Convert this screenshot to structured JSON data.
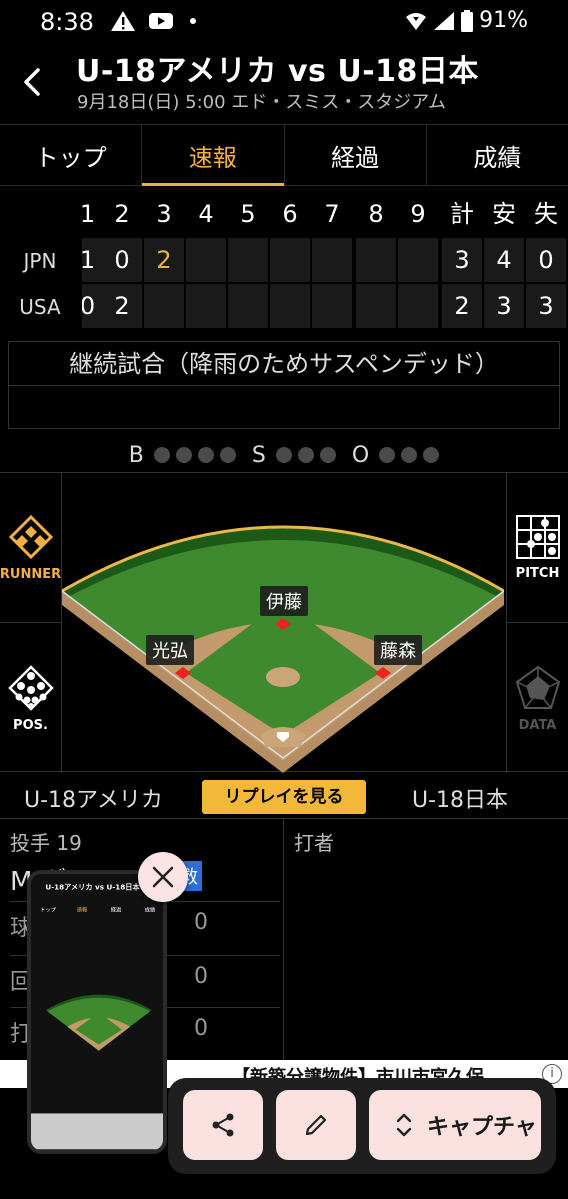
{
  "status": {
    "time": "8:38",
    "battery": "91%"
  },
  "header": {
    "title": "U-18アメリカ vs U-18日本",
    "subtitle": "9月18日(日) 5:00 エド・スミス・スタジアム"
  },
  "tabs": [
    {
      "label": "トップ",
      "active": false
    },
    {
      "label": "速報",
      "active": true
    },
    {
      "label": "経過",
      "active": false
    },
    {
      "label": "成績",
      "active": false
    }
  ],
  "scoreboard": {
    "columns": [
      "1",
      "2",
      "3",
      "4",
      "5",
      "6",
      "7",
      "8",
      "9",
      "計",
      "安",
      "失"
    ],
    "rows": [
      {
        "team": "JPN",
        "cells": [
          "1",
          "0",
          "2",
          "",
          "",
          "",
          "",
          "",
          "",
          "3",
          "4",
          "0"
        ]
      },
      {
        "team": "USA",
        "cells": [
          "0",
          "2",
          "",
          "",
          "",
          "",
          "",
          "",
          "",
          "2",
          "3",
          "3"
        ]
      }
    ]
  },
  "suspend_notice": "継続試合（降雨のためサスペンデッド）",
  "count": {
    "b_label": "B",
    "s_label": "S",
    "o_label": "O"
  },
  "side_buttons": {
    "runner": "RUNNER",
    "pitch": "PITCH",
    "pos": "POS.",
    "data": "DATA"
  },
  "fielders": {
    "center": "伊藤",
    "left": "光弘",
    "right": "藤森"
  },
  "teams": {
    "away": "U-18アメリカ",
    "replay": "リプレイを見る",
    "home": "U-18日本"
  },
  "matchup": {
    "pitcher_label": "投手 19",
    "pitcher_name": "M.グラフ",
    "pitch_type": "救",
    "batter_label": "打者",
    "stats": [
      {
        "label": "球",
        "value": "0"
      },
      {
        "label": "回",
        "value": "0"
      },
      {
        "label": "打",
        "value": "0"
      }
    ]
  },
  "ad": {
    "text": "【新築分譲物件】市川市宮久保"
  },
  "capture_toolbar": {
    "capture_label": "キャプチャ"
  },
  "colors": {
    "accent": "#f2b042",
    "field_grass": "#3f8a2e",
    "dirt": "#b58f63",
    "replay_bg": "#f2b83a",
    "pitch_type_bg": "#2c6fd6"
  }
}
